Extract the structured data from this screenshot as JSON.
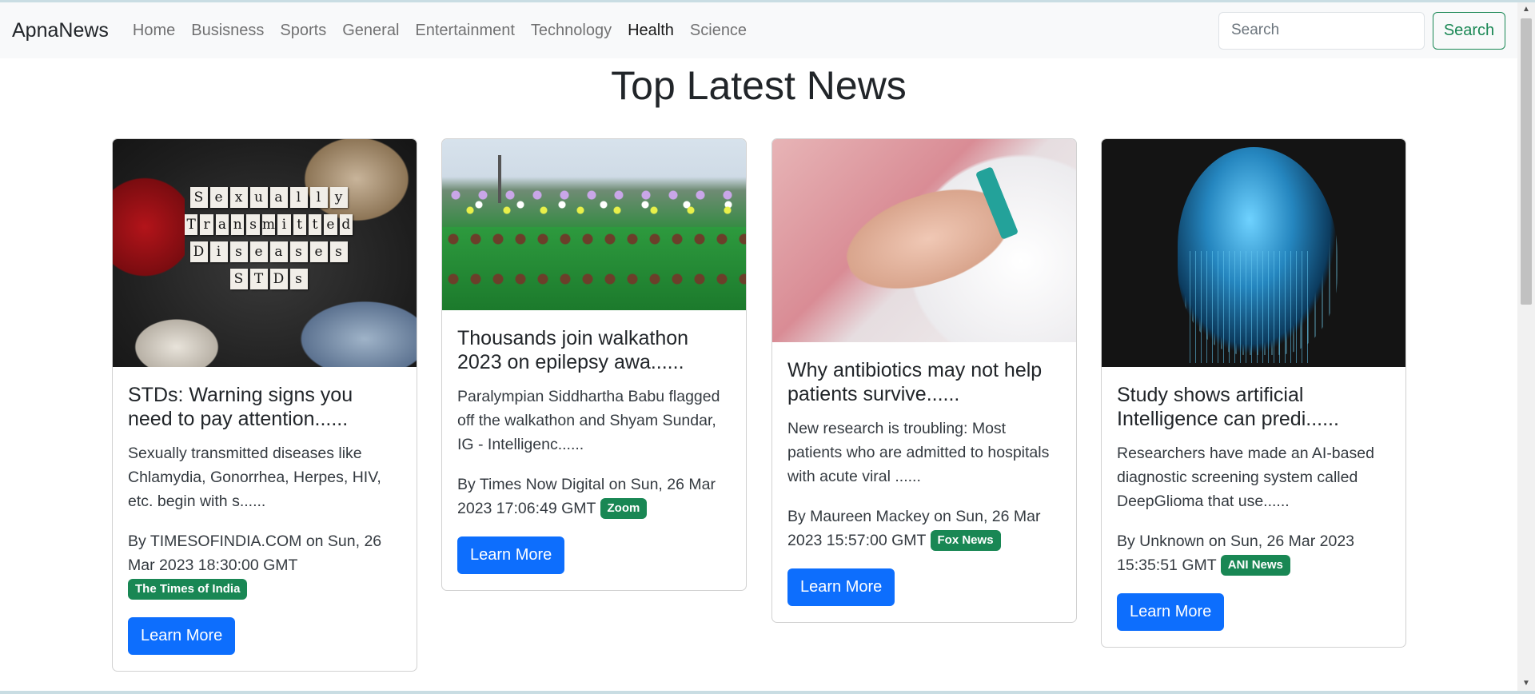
{
  "navbar": {
    "brand": "ApnaNews",
    "links": [
      "Home",
      "Busisness",
      "Sports",
      "General",
      "Entertainment",
      "Technology",
      "Health",
      "Science"
    ],
    "active": "Health",
    "search_placeholder": "Search",
    "search_button": "Search"
  },
  "page_title": "Top Latest News",
  "cards": [
    {
      "title": "STDs: Warning signs you need to pay attention......",
      "description": "Sexually transmitted diseases like Chlamydia, Gonorrhea, Herpes, HIV, etc. begin with s......",
      "meta": "By TIMESOFINDIA.COM on Sun, 26 Mar 2023 18:30:00 GMT",
      "source": "The Times of India",
      "button": "Learn More",
      "image_letters": [
        "Sexually",
        "Transmitted",
        "Diseases",
        "STDs"
      ]
    },
    {
      "title": "Thousands join walkathon 2023 on epilepsy awa......",
      "description": "Paralympian Siddhartha Babu flagged off the walkathon and Shyam Sundar, IG - Intelligenc......",
      "meta": "By Times Now Digital on Sun, 26 Mar 2023 17:06:49 GMT",
      "source": "Zoom",
      "button": "Learn More"
    },
    {
      "title": "Why antibiotics may not help patients survive......",
      "description": "New research is troubling: Most patients who are admitted to hospitals with acute viral ......",
      "meta": "By Maureen Mackey on Sun, 26 Mar 2023 15:57:00 GMT",
      "source": "Fox News",
      "button": "Learn More"
    },
    {
      "title": "Study shows artificial Intelligence can predi......",
      "description": "Researchers have made an AI-based diagnostic screening system called DeepGlioma that use......",
      "meta": "By Unknown on Sun, 26 Mar 2023 15:35:51 GMT",
      "source": "ANI News",
      "button": "Learn More"
    }
  ],
  "colors": {
    "primary": "#0d6efd",
    "success": "#198754",
    "navbar_bg": "#f8f9fa"
  }
}
